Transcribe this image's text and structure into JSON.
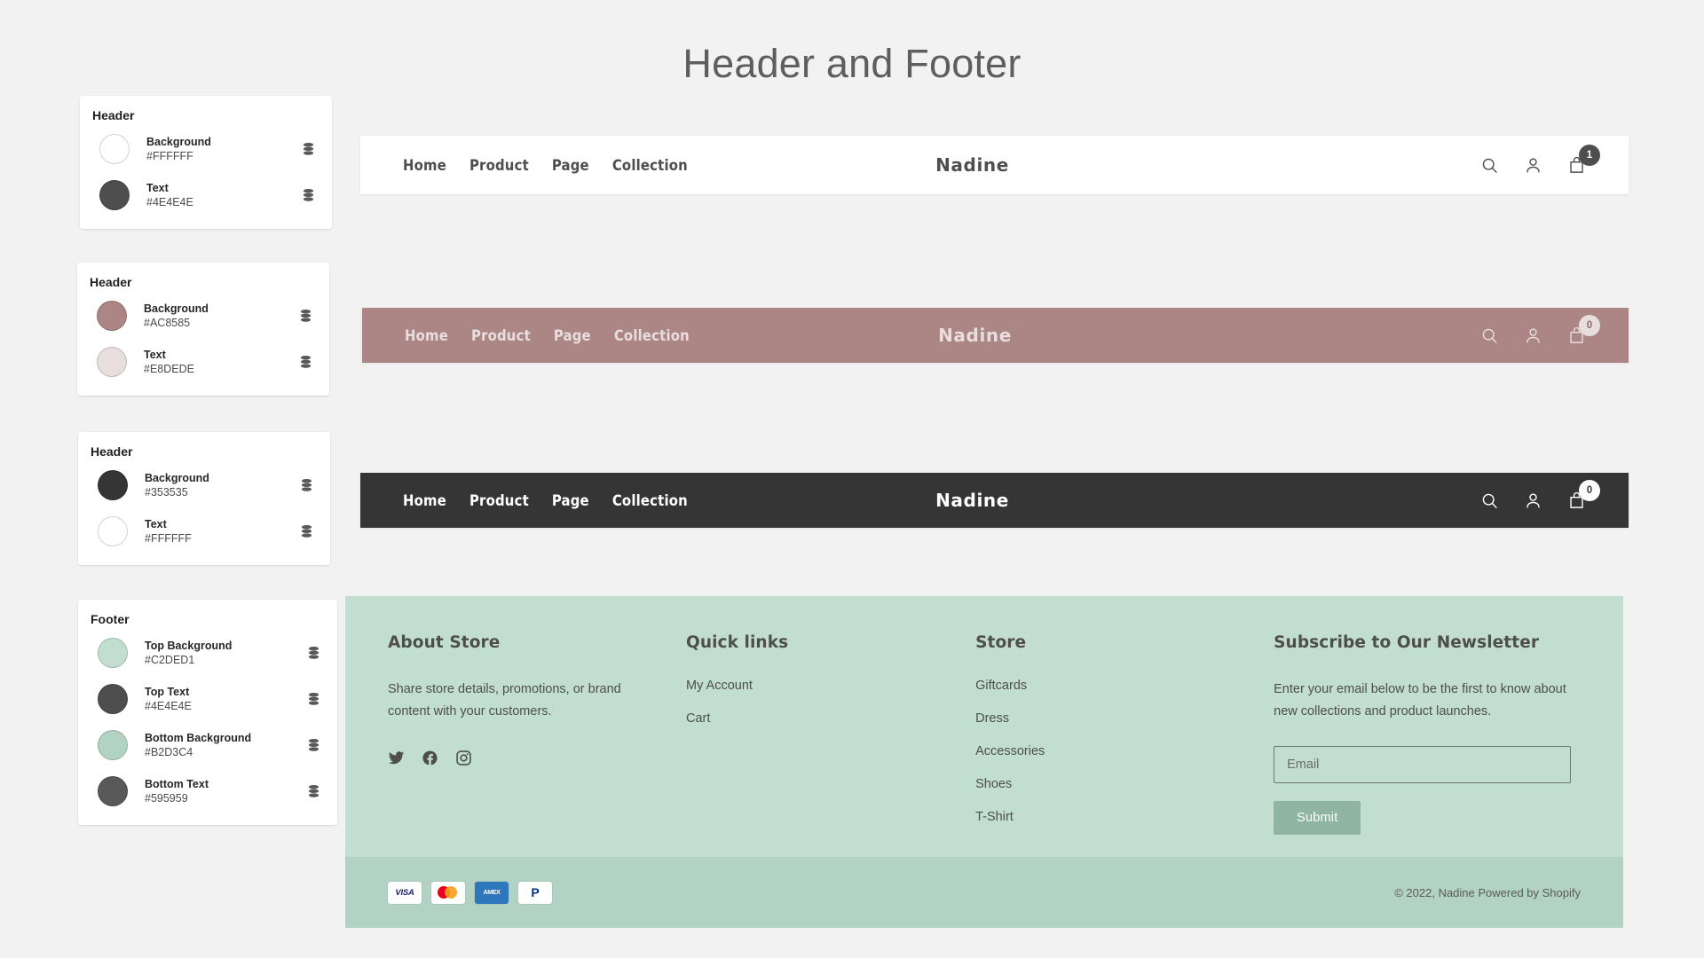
{
  "page": {
    "title": "Header and Footer",
    "background": "#F2F2F2"
  },
  "panels": [
    {
      "title": "Header",
      "rows": [
        {
          "name": "Background",
          "hex": "#FFFFFF",
          "icon": "layers-icon"
        },
        {
          "name": "Text",
          "hex": "#4E4E4E",
          "icon": "layers-icon"
        }
      ]
    },
    {
      "title": "Header",
      "rows": [
        {
          "name": "Background",
          "hex": "#AC8585",
          "icon": "layers-icon"
        },
        {
          "name": "Text",
          "hex": "#E8DEDE",
          "icon": "layers-icon"
        }
      ]
    },
    {
      "title": "Header",
      "rows": [
        {
          "name": "Background",
          "hex": "#353535",
          "icon": "layers-icon"
        },
        {
          "name": "Text",
          "hex": "#FFFFFF",
          "icon": "layers-icon"
        }
      ]
    },
    {
      "title": "Footer",
      "rows": [
        {
          "name": "Top Background",
          "hex": "#C2DED1",
          "icon": "layers-icon"
        },
        {
          "name": "Top Text",
          "hex": "#4E4E4E",
          "icon": "layers-icon"
        },
        {
          "name": "Bottom Background",
          "hex": "#B2D3C4",
          "icon": "layers-icon"
        },
        {
          "name": "Bottom Text",
          "hex": "#595959",
          "icon": "layers-icon"
        }
      ]
    }
  ],
  "headers": [
    {
      "id": "header-light",
      "brand": "Nadine",
      "nav": [
        "Home",
        "Product",
        "Page",
        "Collection"
      ],
      "background": "#FFFFFF",
      "text": "#4E4E4E",
      "cart_count": "1",
      "badge_bg": "#4E4E4E",
      "badge_text": "#FFFFFF",
      "icons": [
        "search-icon",
        "account-icon",
        "cart-icon"
      ]
    },
    {
      "id": "header-rose",
      "brand": "Nadine",
      "nav": [
        "Home",
        "Product",
        "Page",
        "Collection"
      ],
      "background": "#AC8585",
      "text": "#E8DEDE",
      "cart_count": "0",
      "badge_bg": "#E8DEDE",
      "badge_text": "#8A6A6A",
      "icons": [
        "search-icon",
        "account-icon",
        "cart-icon"
      ]
    },
    {
      "id": "header-dark",
      "brand": "Nadine",
      "nav": [
        "Home",
        "Product",
        "Page",
        "Collection"
      ],
      "background": "#353535",
      "text": "#FFFFFF",
      "cart_count": "0",
      "badge_bg": "#FFFFFF",
      "badge_text": "#353535",
      "icons": [
        "search-icon",
        "account-icon",
        "cart-icon"
      ]
    }
  ],
  "footer": {
    "top_background": "#C2DED1",
    "bottom_background": "#B2D3C4",
    "top_text": "#4E4E4E",
    "bottom_text": "#595959",
    "about": {
      "heading": "About Store",
      "body": "Share store details, promotions, or brand content with your customers.",
      "social": [
        "twitter-icon",
        "facebook-icon",
        "instagram-icon"
      ]
    },
    "quick_links": {
      "heading": "Quick links",
      "links": [
        "My Account",
        "Cart"
      ]
    },
    "store": {
      "heading": "Store",
      "links": [
        "Giftcards",
        "Dress",
        "Accessories",
        "Shoes",
        "T-Shirt"
      ]
    },
    "newsletter": {
      "heading": "Subscribe to Our Newsletter",
      "body": "Enter your email below to be the first to know about new collections and product launches.",
      "email_placeholder": "Email",
      "email_value": "",
      "submit_label": "Submit",
      "submit_bg": "#8FB5A2",
      "submit_text": "#FFFFFF"
    },
    "payments": [
      "VISA",
      "Mastercard",
      "AMEX",
      "PayPal"
    ],
    "copyright": "© 2022, Nadine Powered by Shopify"
  }
}
